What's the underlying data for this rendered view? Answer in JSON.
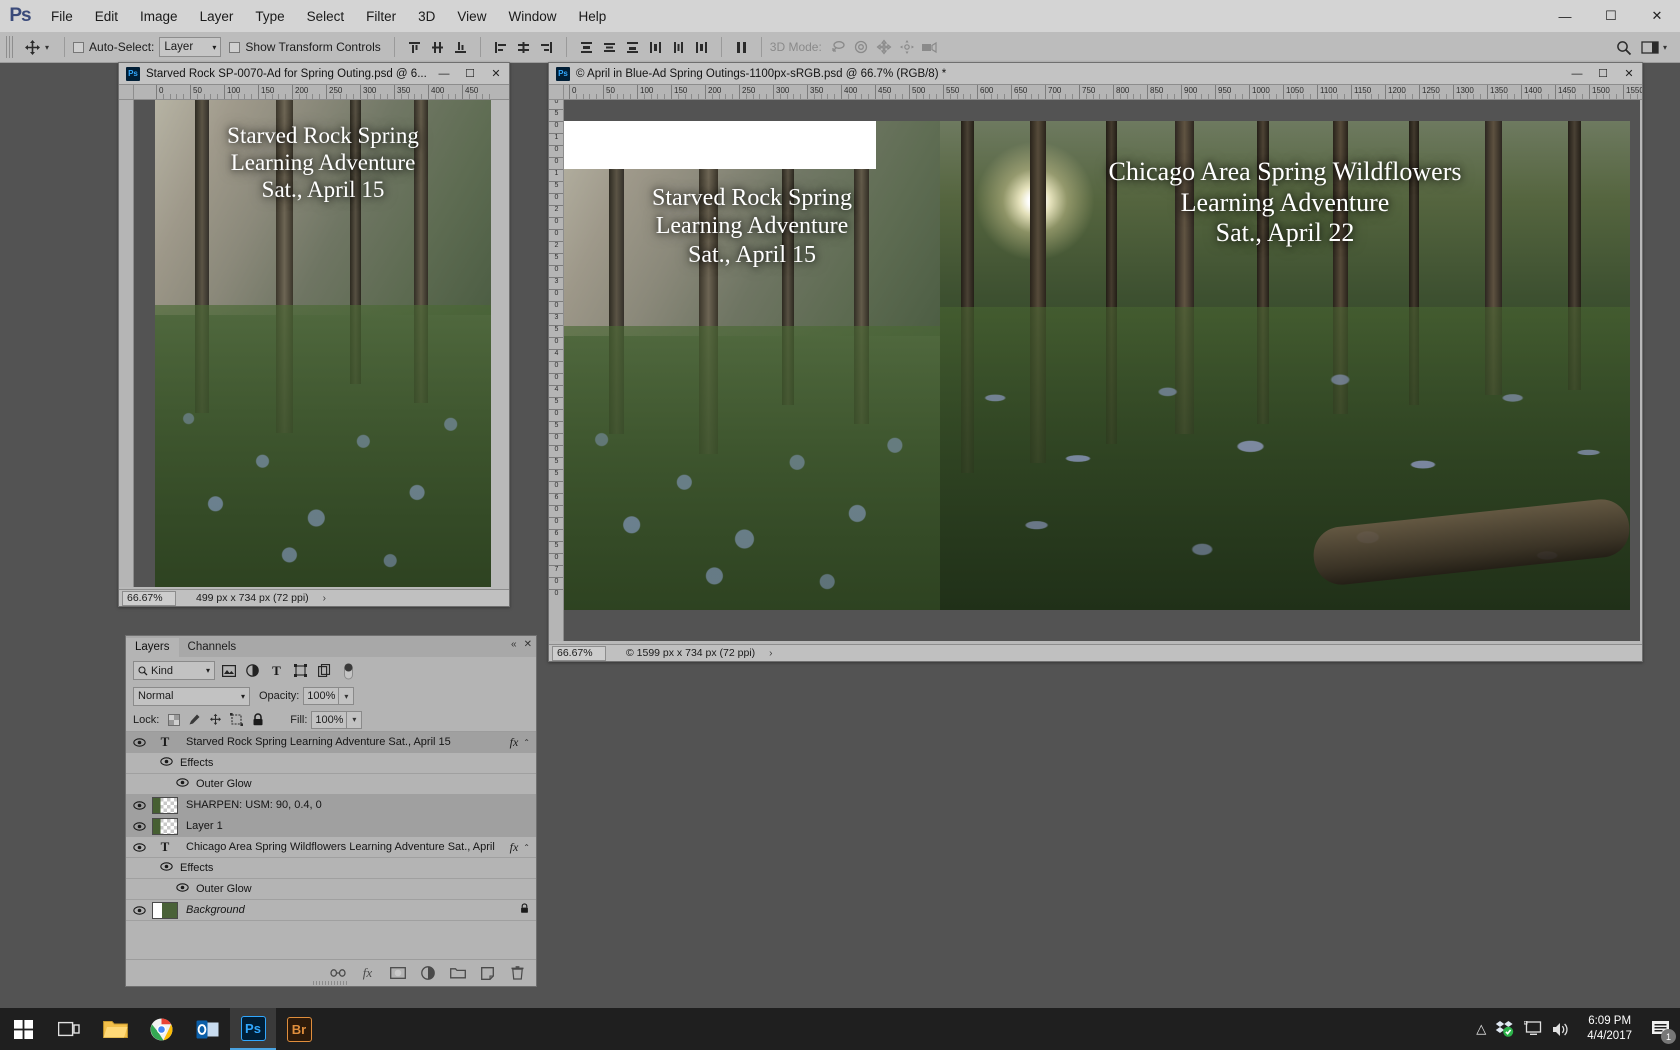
{
  "app": {
    "name": "Ps",
    "logo_text": "Ps"
  },
  "menubar": {
    "items": [
      "File",
      "Edit",
      "Image",
      "Layer",
      "Type",
      "Select",
      "Filter",
      "3D",
      "View",
      "Window",
      "Help"
    ],
    "minimize": "—",
    "maximize": "☐",
    "close": "✕"
  },
  "options_bar": {
    "tool_icon": "move-tool",
    "auto_select_label": "Auto-Select:",
    "auto_select_value": "Layer",
    "show_transform_label": "Show Transform Controls",
    "three_d_mode_label": "3D Mode:",
    "align_icons": [
      "align-top-edges",
      "align-vertical-centers",
      "align-bottom-edges",
      "align-left-edges",
      "align-horizontal-centers",
      "align-right-edges"
    ],
    "distribute_icons": [
      "distribute-top-edges",
      "distribute-vertical-centers",
      "distribute-bottom-edges",
      "distribute-left-edges",
      "distribute-horizontal-centers",
      "distribute-right-edges"
    ],
    "extra_icon": "distribute-spacing",
    "three_d_icons": [
      "3d-orbit",
      "3d-roll",
      "3d-pan",
      "3d-slide",
      "3d-camera"
    ],
    "right_icons": [
      "search-icon",
      "workspace-icon",
      "chevron-down-icon"
    ]
  },
  "documents": [
    {
      "id": "doc-left",
      "title": "Starved Rock SP-0070-Ad for Spring Outing.psd @ 6...",
      "zoom": "66.67%",
      "status": "499 px x 734 px (72 ppi)",
      "status_arrow": "›",
      "overlay_lines": [
        "Starved Rock Spring",
        "Learning Adventure",
        "Sat., April 15"
      ],
      "minimize": "—",
      "maximize": "☐",
      "close": "✕",
      "ruler_ticks": [
        "0",
        "50",
        "100",
        "150",
        "200",
        "250",
        "300",
        "350",
        "400",
        "450"
      ]
    },
    {
      "id": "doc-right",
      "title": "© April in Blue-Ad Spring Outings-1100px-sRGB.psd @ 66.7% (RGB/8) *",
      "zoom": "66.67%",
      "status": "© 1599 px x 734 px (72 ppi)",
      "status_arrow": "›",
      "overlay_left_lines": [
        "Starved Rock Spring",
        "Learning Adventure",
        "Sat., April 15"
      ],
      "overlay_right_lines": [
        "Chicago Area Spring Wildflowers",
        "Learning Adventure",
        "Sat., April 22"
      ],
      "minimize": "—",
      "maximize": "☐",
      "close": "✕",
      "ruler_ticks": [
        "0",
        "50",
        "100",
        "150",
        "200",
        "250",
        "300",
        "350",
        "400",
        "450",
        "500",
        "550",
        "600",
        "650",
        "700",
        "750",
        "800",
        "850",
        "900",
        "950",
        "1000",
        "1050",
        "1100",
        "1150",
        "1200",
        "1250",
        "1300",
        "1350",
        "1400",
        "1450",
        "1500",
        "1550"
      ],
      "ruler_v_ticks": [
        "0",
        "0",
        "5",
        "0",
        "1",
        "0",
        "0",
        "1",
        "5",
        "0",
        "2",
        "0",
        "0",
        "2",
        "5",
        "0",
        "3",
        "0",
        "0",
        "3",
        "5",
        "0",
        "4",
        "0",
        "0",
        "4",
        "5",
        "0",
        "5",
        "0",
        "0",
        "5",
        "5",
        "0",
        "6",
        "0",
        "0",
        "6",
        "5",
        "0",
        "7",
        "0",
        "0"
      ]
    }
  ],
  "layers_panel": {
    "tabs": [
      {
        "label": "Layers",
        "active": true
      },
      {
        "label": "Channels",
        "active": false
      }
    ],
    "collapse_icon": "«",
    "close_icon": "✕",
    "filter": {
      "kind_label": "Kind",
      "search_icon": "search-icon",
      "icons": [
        "filter-pixel-icon",
        "filter-adjustment-icon",
        "filter-type-icon",
        "filter-shape-icon",
        "filter-smart-object-icon"
      ],
      "toggle": "filter-toggle"
    },
    "blend_mode": "Normal",
    "opacity_label": "Opacity:",
    "opacity_value": "100%",
    "lock_label": "Lock:",
    "lock_icons": [
      "lock-transparent-pixels",
      "lock-image-pixels",
      "lock-position",
      "lock-artboard",
      "lock-all"
    ],
    "fill_label": "Fill:",
    "fill_value": "100%",
    "layers": [
      {
        "name": "Starved Rock Spring Learning Adventure Sat., April 15",
        "type": "text",
        "selected": true,
        "fx": "fx",
        "caret": "⌃",
        "visible": true
      },
      {
        "name": "Effects",
        "type": "effects-group",
        "indent": 1,
        "visible": true
      },
      {
        "name": "Outer Glow",
        "type": "effect",
        "indent": 2,
        "visible": true
      },
      {
        "name": "SHARPEN: USM: 90, 0.4, 0",
        "type": "pixel",
        "selected": true,
        "visible": true
      },
      {
        "name": "Layer 1",
        "type": "pixel",
        "selected": true,
        "visible": true
      },
      {
        "name": "Chicago Area Spring Wildflowers Learning Adventure Sat., April",
        "type": "text",
        "fx": "fx",
        "caret": "⌃",
        "visible": true
      },
      {
        "name": "Effects",
        "type": "effects-group",
        "indent": 1,
        "visible": true
      },
      {
        "name": "Outer Glow",
        "type": "effect",
        "indent": 2,
        "visible": true
      },
      {
        "name": "Background",
        "type": "background",
        "italic": true,
        "locked": "🔒",
        "visible": true
      }
    ],
    "footer_buttons": [
      "link-layers-icon",
      "add-layer-style-icon",
      "add-layer-mask-icon",
      "new-adjustment-layer-icon",
      "new-group-icon",
      "new-layer-icon",
      "delete-layer-icon"
    ]
  },
  "taskbar": {
    "start_icon": "windows-start-icon",
    "items": [
      {
        "icon": "task-view-icon",
        "name": "task-view"
      },
      {
        "icon": "file-explorer-icon",
        "name": "file-explorer"
      },
      {
        "icon": "chrome-icon",
        "name": "google-chrome"
      },
      {
        "icon": "outlook-icon",
        "name": "outlook"
      },
      {
        "icon": "photoshop-icon",
        "name": "photoshop",
        "active": true,
        "label": "Ps"
      },
      {
        "icon": "bridge-icon",
        "name": "adobe-bridge",
        "label": "Br"
      }
    ],
    "tray": {
      "chevron": "⌃",
      "icons": [
        "dropbox-icon",
        "display-icon",
        "volume-icon"
      ],
      "time": "6:09 PM",
      "date": "4/4/2017",
      "notification_count": "1"
    }
  }
}
